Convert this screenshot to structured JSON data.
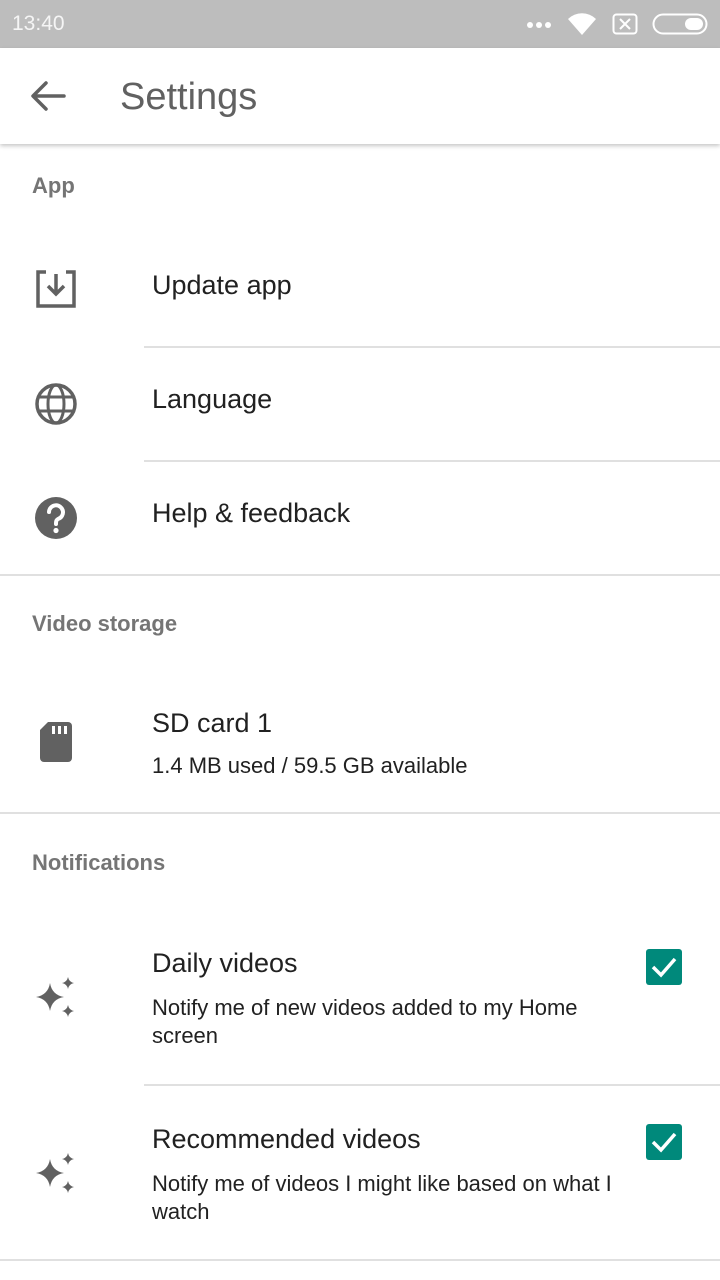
{
  "status_bar": {
    "time": "13:40"
  },
  "app_bar": {
    "title": "Settings",
    "back_icon": "arrow-back-icon"
  },
  "sections": {
    "app": {
      "header": "App",
      "items": [
        {
          "label": "Update app",
          "icon": "download-icon"
        },
        {
          "label": "Language",
          "icon": "globe-icon"
        },
        {
          "label": "Help & feedback",
          "icon": "help-icon"
        }
      ]
    },
    "video_storage": {
      "header": "Video storage",
      "item": {
        "label": "SD card 1",
        "sub": "1.4 MB used / 59.5 GB available",
        "icon": "sd-card-icon"
      }
    },
    "notifications": {
      "header": "Notifications",
      "items": [
        {
          "label": "Daily videos",
          "sub": "Notify me of new videos added to my Home screen",
          "checked": true,
          "icon": "sparkle-icon"
        },
        {
          "label": "Recommended videos",
          "sub": "Notify me of videos I might like based on what I watch",
          "checked": true,
          "icon": "sparkle-icon"
        }
      ]
    }
  },
  "colors": {
    "accent": "#00897b",
    "status_bar": "#bdbdbd",
    "header_text": "#757575"
  }
}
